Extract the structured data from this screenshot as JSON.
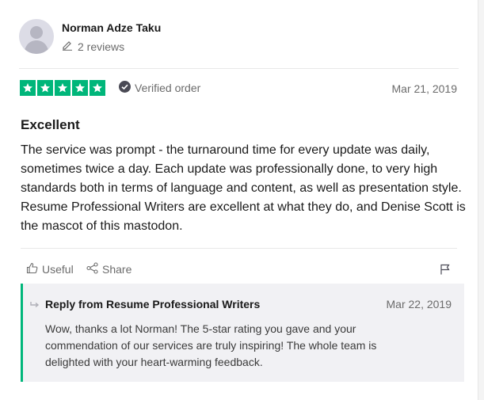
{
  "reviewer": {
    "name": "Norman Adze Taku",
    "review_count": "2 reviews",
    "avatar_icon": "user-silhouette-icon"
  },
  "review": {
    "rating": 5,
    "rating_max": 5,
    "star_color": "#00b67a",
    "verified_label": "Verified order",
    "date": "Mar 21, 2019",
    "title": "Excellent",
    "body": "The service was prompt - the turnaround time for every update was daily, sometimes twice a day. Each update was professionally done, to very high standards both in terms of language and content, as well as presentation style. Resume Professional Writers are excellent at what they do, and Denise Scott is the mascot of this mastodon."
  },
  "actions": {
    "useful_label": "Useful",
    "share_label": "Share",
    "useful_icon": "thumbs-up-icon",
    "share_icon": "share-icon",
    "flag_icon": "flag-icon"
  },
  "reply": {
    "from": "Reply from Resume Professional Writers",
    "date": "Mar 22, 2019",
    "body": "Wow, thanks a lot Norman! The 5-star rating you gave and your commendation of our services are truly inspiring! The whole team is delighted with your heart-warming feedback.",
    "accent_color": "#00b67a",
    "icon": "reply-arrow-icon"
  }
}
